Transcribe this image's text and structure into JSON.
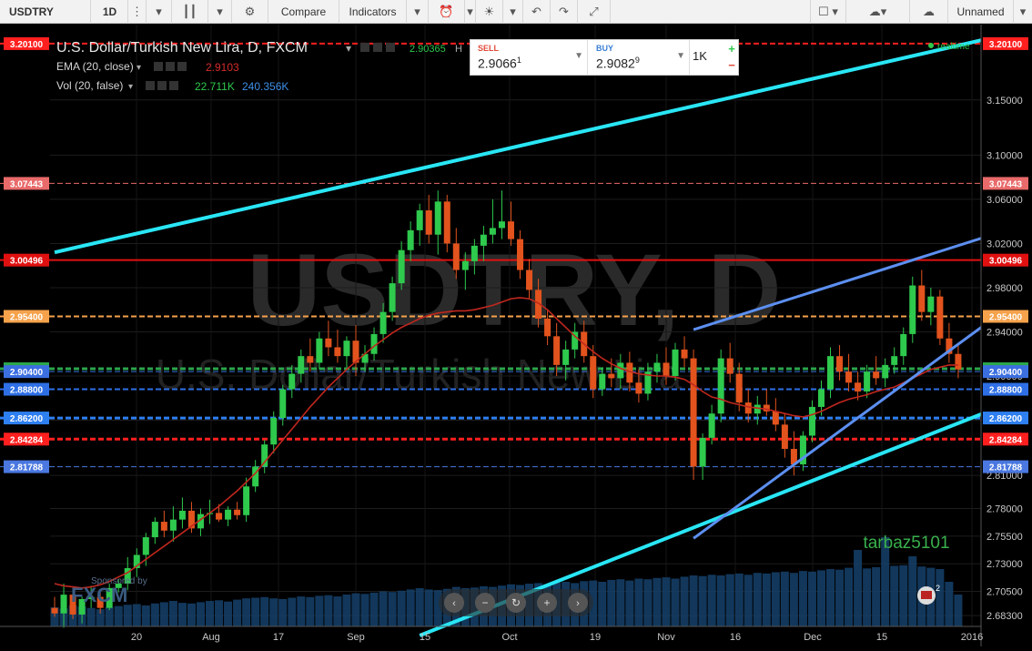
{
  "toolbar": {
    "symbol": "USDTRY",
    "interval": "1D",
    "compare": "Compare",
    "indicators": "Indicators",
    "layout_name": "Unnamed"
  },
  "legend": {
    "title": "U.S. Dollar/Turkish New Lira, D, FXCM",
    "ohlc_text": "2.90365",
    "ohlc_prefix": "H",
    "ema_label": "EMA (20, close)",
    "ema_value": "2.9103",
    "vol_label": "Vol (20, false)",
    "vol_value1": "22.711K",
    "vol_value2": "240.356K",
    "realtime": "realtime"
  },
  "trade": {
    "sell_label": "SELL",
    "sell_price": "2.9066",
    "sell_sup": "1",
    "buy_label": "BUY",
    "buy_price": "2.9082",
    "buy_sup": "9",
    "quantity": "1K",
    "plus": "+",
    "minus": "−"
  },
  "watermark": {
    "symbol": "USDTRY, D",
    "name": "U.S. Dollar/Turkish New Lira"
  },
  "sponsor": {
    "label": "Sponsored by",
    "name": "FXCM"
  },
  "user_tag": "tarbaz5101",
  "chart_data": {
    "type": "candlestick",
    "title": "U.S. Dollar/Turkish New Lira, D, FXCM",
    "ylim": [
      2.665,
      3.21
    ],
    "y_ticks": [
      "3.15000",
      "3.10000",
      "3.06000",
      "3.02000",
      "2.98000",
      "2.94000",
      "2.90000",
      "2.86000",
      "2.81000",
      "2.78000",
      "2.75500",
      "2.73000",
      "2.70500",
      "2.68300"
    ],
    "x_ticks": [
      "20",
      "Aug",
      "17",
      "Sep",
      "15",
      "Oct",
      "19",
      "Nov",
      "16",
      "Dec",
      "15",
      "2016"
    ],
    "price_lines": [
      {
        "label": "3.20100",
        "value": 3.201,
        "color": "#ff1f1f",
        "style": "dashed",
        "width": 2
      },
      {
        "label": "3.07443",
        "value": 3.07443,
        "color": "#e96a6a",
        "style": "dashed",
        "width": 1
      },
      {
        "label": "3.00496",
        "value": 3.00496,
        "color": "#e01010",
        "style": "solid",
        "width": 2
      },
      {
        "label": "2.95400",
        "value": 2.954,
        "color": "#f5a24b",
        "style": "dashed",
        "width": 2
      },
      {
        "label": "2.90661",
        "value": 2.90661,
        "color": "#2aa64b",
        "style": "dashed",
        "width": 3
      },
      {
        "label": "2.90400",
        "value": 2.904,
        "color": "#3b6fe0",
        "style": "dashed",
        "width": 1
      },
      {
        "label": "2.88800",
        "value": 2.888,
        "color": "#2e6fe6",
        "style": "dashed",
        "width": 2
      },
      {
        "label": "2.86200",
        "value": 2.862,
        "color": "#2e7ff0",
        "style": "dashed",
        "width": 3
      },
      {
        "label": "2.84284",
        "value": 2.84284,
        "color": "#ff1f1f",
        "style": "dashed",
        "width": 3
      },
      {
        "label": "2.81788",
        "value": 2.81788,
        "color": "#4a78e0",
        "style": "dashed",
        "width": 1
      }
    ],
    "candles": [
      [
        2.69,
        2.7,
        2.682,
        2.685
      ],
      [
        2.685,
        2.712,
        2.672,
        2.702
      ],
      [
        2.702,
        2.708,
        2.68,
        2.684
      ],
      [
        2.684,
        2.7,
        2.676,
        2.698
      ],
      [
        2.698,
        2.71,
        2.69,
        2.7
      ],
      [
        2.7,
        2.707,
        2.685,
        2.69
      ],
      [
        2.69,
        2.712,
        2.688,
        2.708
      ],
      [
        2.708,
        2.716,
        2.704,
        2.712
      ],
      [
        2.712,
        2.736,
        2.706,
        2.726
      ],
      [
        2.726,
        2.744,
        2.718,
        2.738
      ],
      [
        2.738,
        2.758,
        2.728,
        2.754
      ],
      [
        2.754,
        2.772,
        2.748,
        2.768
      ],
      [
        2.768,
        2.778,
        2.754,
        2.76
      ],
      [
        2.76,
        2.782,
        2.75,
        2.77
      ],
      [
        2.77,
        2.79,
        2.762,
        2.778
      ],
      [
        2.778,
        2.786,
        2.758,
        2.762
      ],
      [
        2.762,
        2.78,
        2.755,
        2.775
      ],
      [
        2.775,
        2.788,
        2.766,
        2.776
      ],
      [
        2.776,
        2.784,
        2.768,
        2.77
      ],
      [
        2.77,
        2.782,
        2.764,
        2.779
      ],
      [
        2.779,
        2.786,
        2.77,
        2.774
      ],
      [
        2.774,
        2.808,
        2.768,
        2.8
      ],
      [
        2.8,
        2.824,
        2.795,
        2.818
      ],
      [
        2.818,
        2.842,
        2.812,
        2.838
      ],
      [
        2.838,
        2.868,
        2.83,
        2.862
      ],
      [
        2.862,
        2.892,
        2.855,
        2.888
      ],
      [
        2.888,
        2.91,
        2.88,
        2.902
      ],
      [
        2.902,
        2.924,
        2.894,
        2.918
      ],
      [
        2.918,
        2.934,
        2.904,
        2.912
      ],
      [
        2.912,
        2.94,
        2.906,
        2.934
      ],
      [
        2.934,
        2.95,
        2.918,
        2.926
      ],
      [
        2.926,
        2.942,
        2.912,
        2.918
      ],
      [
        2.918,
        2.936,
        2.908,
        2.932
      ],
      [
        2.932,
        2.946,
        2.9,
        2.912
      ],
      [
        2.912,
        2.928,
        2.904,
        2.92
      ],
      [
        2.92,
        2.944,
        2.914,
        2.938
      ],
      [
        2.938,
        2.966,
        2.93,
        2.958
      ],
      [
        2.958,
        2.99,
        2.95,
        2.984
      ],
      [
        2.984,
        3.022,
        2.978,
        3.014
      ],
      [
        3.014,
        3.04,
        3.004,
        3.032
      ],
      [
        3.032,
        3.056,
        3.018,
        3.05
      ],
      [
        3.05,
        3.064,
        3.02,
        3.028
      ],
      [
        3.028,
        3.068,
        3.01,
        3.058
      ],
      [
        3.058,
        3.064,
        3.012,
        3.02
      ],
      [
        3.02,
        3.034,
        2.988,
        2.996
      ],
      [
        2.996,
        3.012,
        2.978,
        3.004
      ],
      [
        3.004,
        3.024,
        2.992,
        3.018
      ],
      [
        3.018,
        3.036,
        3.004,
        3.028
      ],
      [
        3.028,
        3.06,
        3.02,
        3.034
      ],
      [
        3.034,
        3.068,
        3.024,
        3.04
      ],
      [
        3.04,
        3.058,
        3.018,
        3.024
      ],
      [
        3.024,
        3.032,
        2.988,
        2.996
      ],
      [
        2.996,
        3.006,
        2.97,
        2.978
      ],
      [
        2.978,
        2.988,
        2.944,
        2.952
      ],
      [
        2.952,
        2.96,
        2.928,
        2.936
      ],
      [
        2.936,
        2.948,
        2.9,
        2.91
      ],
      [
        2.91,
        2.932,
        2.896,
        2.924
      ],
      [
        2.924,
        2.948,
        2.916,
        2.94
      ],
      [
        2.94,
        2.95,
        2.912,
        2.918
      ],
      [
        2.918,
        2.928,
        2.88,
        2.888
      ],
      [
        2.888,
        2.908,
        2.882,
        2.902
      ],
      [
        2.902,
        2.916,
        2.89,
        2.898
      ],
      [
        2.898,
        2.92,
        2.888,
        2.912
      ],
      [
        2.912,
        2.922,
        2.886,
        2.894
      ],
      [
        2.894,
        2.906,
        2.876,
        2.884
      ],
      [
        2.884,
        2.912,
        2.878,
        2.904
      ],
      [
        2.904,
        2.92,
        2.894,
        2.912
      ],
      [
        2.912,
        2.926,
        2.892,
        2.9
      ],
      [
        2.9,
        2.93,
        2.896,
        2.924
      ],
      [
        2.924,
        2.936,
        2.908,
        2.916
      ],
      [
        2.916,
        2.924,
        2.806,
        2.818
      ],
      [
        2.818,
        2.848,
        2.806,
        2.844
      ],
      [
        2.844,
        2.874,
        2.838,
        2.866
      ],
      [
        2.866,
        2.924,
        2.858,
        2.916
      ],
      [
        2.916,
        2.93,
        2.894,
        2.902
      ],
      [
        2.902,
        2.912,
        2.868,
        2.876
      ],
      [
        2.876,
        2.888,
        2.858,
        2.866
      ],
      [
        2.866,
        2.882,
        2.856,
        2.874
      ],
      [
        2.874,
        2.888,
        2.864,
        2.868
      ],
      [
        2.868,
        2.88,
        2.85,
        2.856
      ],
      [
        2.856,
        2.866,
        2.826,
        2.834
      ],
      [
        2.834,
        2.85,
        2.81,
        2.82
      ],
      [
        2.82,
        2.85,
        2.814,
        2.846
      ],
      [
        2.846,
        2.878,
        2.84,
        2.872
      ],
      [
        2.872,
        2.896,
        2.864,
        2.888
      ],
      [
        2.888,
        2.926,
        2.88,
        2.918
      ],
      [
        2.918,
        2.928,
        2.896,
        2.904
      ],
      [
        2.904,
        2.92,
        2.886,
        2.894
      ],
      [
        2.894,
        2.904,
        2.878,
        2.886
      ],
      [
        2.886,
        2.91,
        2.88,
        2.904
      ],
      [
        2.904,
        2.918,
        2.892,
        2.898
      ],
      [
        2.898,
        2.916,
        2.89,
        2.91
      ],
      [
        2.91,
        2.926,
        2.902,
        2.918
      ],
      [
        2.918,
        2.944,
        2.91,
        2.938
      ],
      [
        2.938,
        2.99,
        2.93,
        2.982
      ],
      [
        2.982,
        2.996,
        2.95,
        2.958
      ],
      [
        2.958,
        2.98,
        2.946,
        2.972
      ],
      [
        2.972,
        2.978,
        2.928,
        2.934
      ],
      [
        2.934,
        2.948,
        2.912,
        2.92
      ],
      [
        2.92,
        2.93,
        2.898,
        2.906
      ]
    ],
    "ema20": [
      2.712,
      2.71,
      2.709,
      2.708,
      2.709,
      2.711,
      2.714,
      2.718,
      2.722,
      2.728,
      2.734,
      2.74,
      2.746,
      2.752,
      2.758,
      2.764,
      2.77,
      2.776,
      2.782,
      2.789,
      2.796,
      2.804,
      2.812,
      2.822,
      2.832,
      2.842,
      2.852,
      2.862,
      2.872,
      2.881,
      2.89,
      2.898,
      2.906,
      2.913,
      2.92,
      2.927,
      2.933,
      2.939,
      2.944,
      2.948,
      2.952,
      2.955,
      2.957,
      2.958,
      2.959,
      2.959,
      2.96,
      2.962,
      2.964,
      2.967,
      2.97,
      2.971,
      2.97,
      2.966,
      2.96,
      2.952,
      2.944,
      2.936,
      2.929,
      2.922,
      2.916,
      2.911,
      2.907,
      2.904,
      2.902,
      2.901,
      2.9,
      2.9,
      2.899,
      2.897,
      2.892,
      2.886,
      2.881,
      2.879,
      2.876,
      2.874,
      2.872,
      2.871,
      2.87,
      2.868,
      2.866,
      2.864,
      2.863,
      2.865,
      2.868,
      2.872,
      2.876,
      2.879,
      2.881,
      2.883,
      2.886,
      2.888,
      2.89,
      2.894,
      2.898,
      2.902,
      2.906,
      2.908,
      2.91,
      2.91
    ],
    "volume": [
      0.3,
      0.28,
      0.33,
      0.31,
      0.29,
      0.27,
      0.3,
      0.32,
      0.34,
      0.35,
      0.33,
      0.36,
      0.38,
      0.4,
      0.37,
      0.36,
      0.38,
      0.4,
      0.41,
      0.39,
      0.42,
      0.44,
      0.45,
      0.46,
      0.44,
      0.43,
      0.45,
      0.47,
      0.46,
      0.48,
      0.49,
      0.47,
      0.5,
      0.52,
      0.51,
      0.53,
      0.55,
      0.54,
      0.56,
      0.58,
      0.6,
      0.58,
      0.57,
      0.59,
      0.62,
      0.6,
      0.61,
      0.63,
      0.62,
      0.64,
      0.66,
      0.65,
      0.67,
      0.68,
      0.66,
      0.69,
      0.7,
      0.68,
      0.71,
      0.72,
      0.7,
      0.73,
      0.74,
      0.72,
      0.75,
      0.74,
      0.76,
      0.77,
      0.75,
      0.78,
      0.8,
      0.79,
      0.81,
      0.8,
      0.82,
      0.83,
      0.81,
      0.84,
      0.83,
      0.85,
      0.86,
      0.84,
      0.87,
      0.86,
      0.88,
      0.9,
      0.89,
      0.92,
      1.2,
      0.91,
      0.93,
      1.4,
      0.95,
      0.96,
      1.1,
      0.94,
      0.92,
      0.9,
      0.7,
      0.5
    ],
    "trendlines": [
      {
        "name": "upper-channel",
        "color": "#29e6f5",
        "width": 4,
        "points": [
          [
            0,
            3.012
          ],
          [
            102,
            3.205
          ]
        ]
      },
      {
        "name": "lower-channel",
        "color": "#29e6f5",
        "width": 4,
        "points": [
          [
            40,
            2.665
          ],
          [
            102,
            2.867
          ]
        ]
      },
      {
        "name": "rising-support",
        "color": "#5c8ff0",
        "width": 3,
        "points": [
          [
            70,
            2.753
          ],
          [
            102,
            2.947
          ]
        ]
      },
      {
        "name": "rising-resistance",
        "color": "#5c8ff0",
        "width": 3,
        "points": [
          [
            70,
            2.942
          ],
          [
            102,
            3.026
          ]
        ]
      }
    ]
  }
}
